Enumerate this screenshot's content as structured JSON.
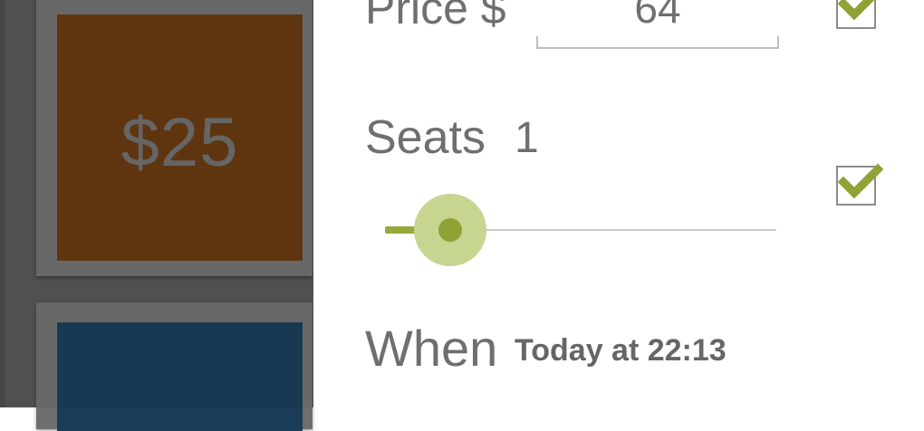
{
  "background_list": {
    "cards": [
      {
        "price": "$25",
        "color": "#653811"
      },
      {
        "price": "",
        "color": "#1b3d57"
      }
    ]
  },
  "panel": {
    "price": {
      "label": "Price $",
      "value": "64",
      "checked": true
    },
    "seats": {
      "label": "Seats",
      "value": "1",
      "checked": true,
      "slider_fraction": 0.17
    },
    "when": {
      "label": "When",
      "value": "Today at 22:13"
    }
  },
  "colors": {
    "accent": "#8fa235",
    "accent_light": "#c6d58f",
    "text": "#6f6f6f"
  }
}
